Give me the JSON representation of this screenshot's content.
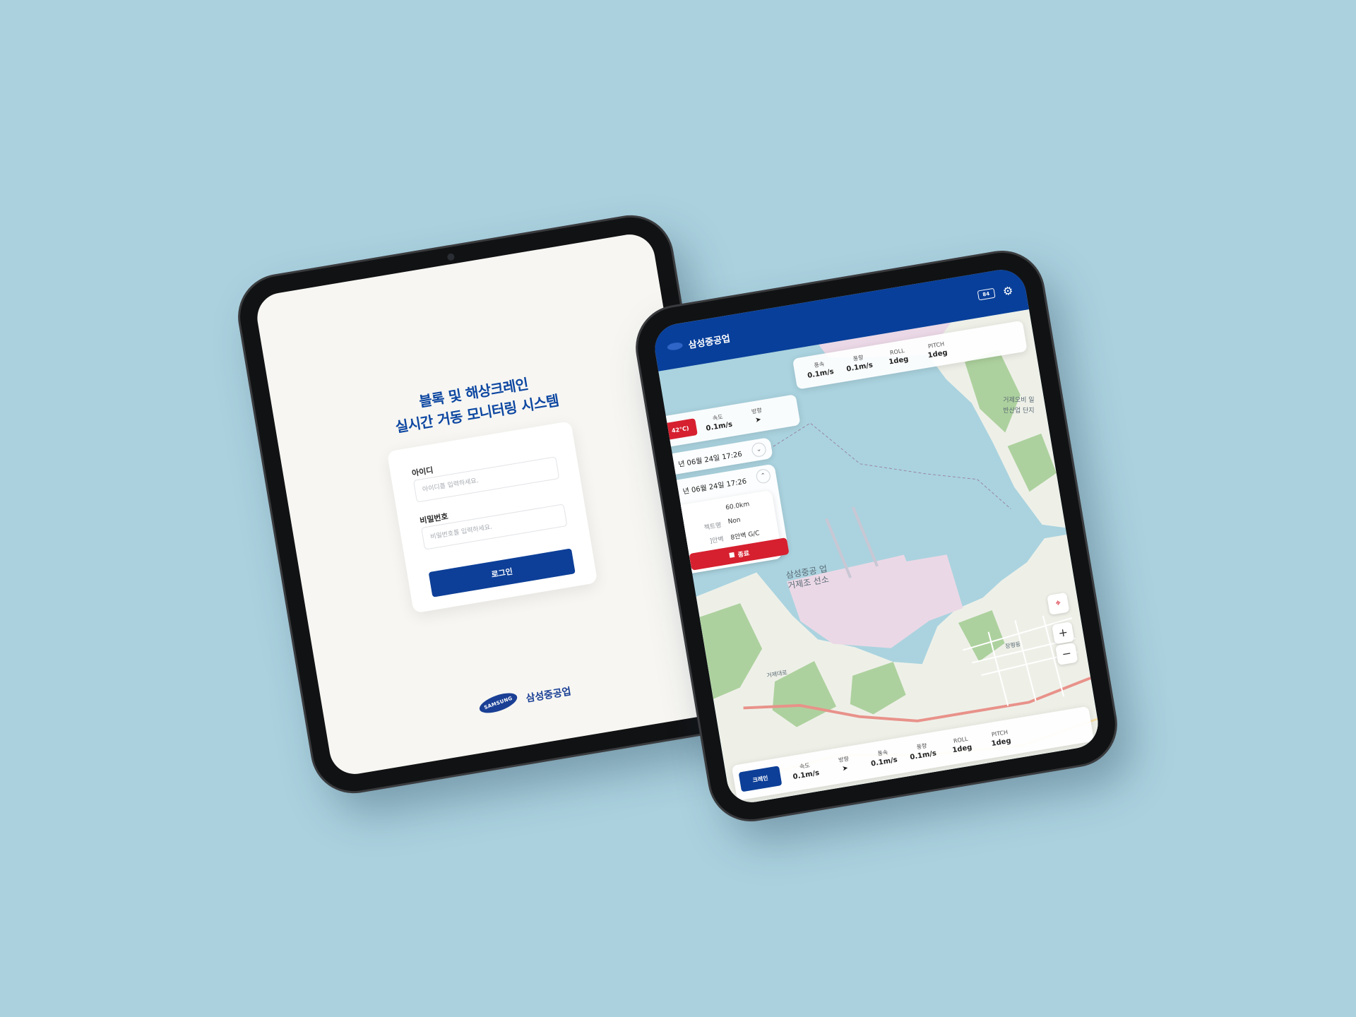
{
  "login": {
    "title_line1": "블록 및 해상크레인",
    "title_line2": "실시간 거동 모니터링 시스템",
    "id_label": "아이디",
    "id_placeholder": "아이디를 입력하세요.",
    "pw_label": "비밀번호",
    "pw_placeholder": "비밀번호를 입력하세요.",
    "login_button": "로그인",
    "logo_text": "SAMSUNG",
    "brand_name": "삼성중공업"
  },
  "map_app": {
    "header_title": "삼성중공업",
    "battery": "84",
    "top_stats": [
      {
        "label": "속도",
        "value": "0.1m/s"
      },
      {
        "label": "방향",
        "value": ""
      },
      {
        "label": "풍속",
        "value": "0.1m/s"
      },
      {
        "label": "풍향",
        "value": "0.1m/s"
      },
      {
        "label": "ROLL",
        "value": "1deg"
      },
      {
        "label": "PITCH",
        "value": "1deg"
      }
    ],
    "temp_chip": "42°C)",
    "date_1": "년 06월 24일 17:26",
    "date_2": "년 06월 24일 17:26",
    "details": [
      {
        "label": "",
        "value": "60.0km"
      },
      {
        "label": "젝트명",
        "value": "Non"
      },
      {
        "label": "]안벽",
        "value": "8안벽 G/C"
      }
    ],
    "end_button": "종료",
    "bottom_button": "크레인",
    "bottom_stats": [
      {
        "label": "속도",
        "value": "0.1m/s"
      },
      {
        "label": "방향",
        "value": ""
      },
      {
        "label": "풍속",
        "value": "0.1m/s"
      },
      {
        "label": "풍향",
        "value": "0.1m/s"
      },
      {
        "label": "ROLL",
        "value": "1deg"
      },
      {
        "label": "PITCH",
        "value": "1deg"
      }
    ],
    "map_labels": {
      "yard": "삼성중공 업 거제조 선소",
      "road": "거제대로",
      "district": "장평동",
      "complex": "거제오비 일반산업 단지"
    },
    "zoom_in": "+",
    "zoom_out": "−"
  }
}
